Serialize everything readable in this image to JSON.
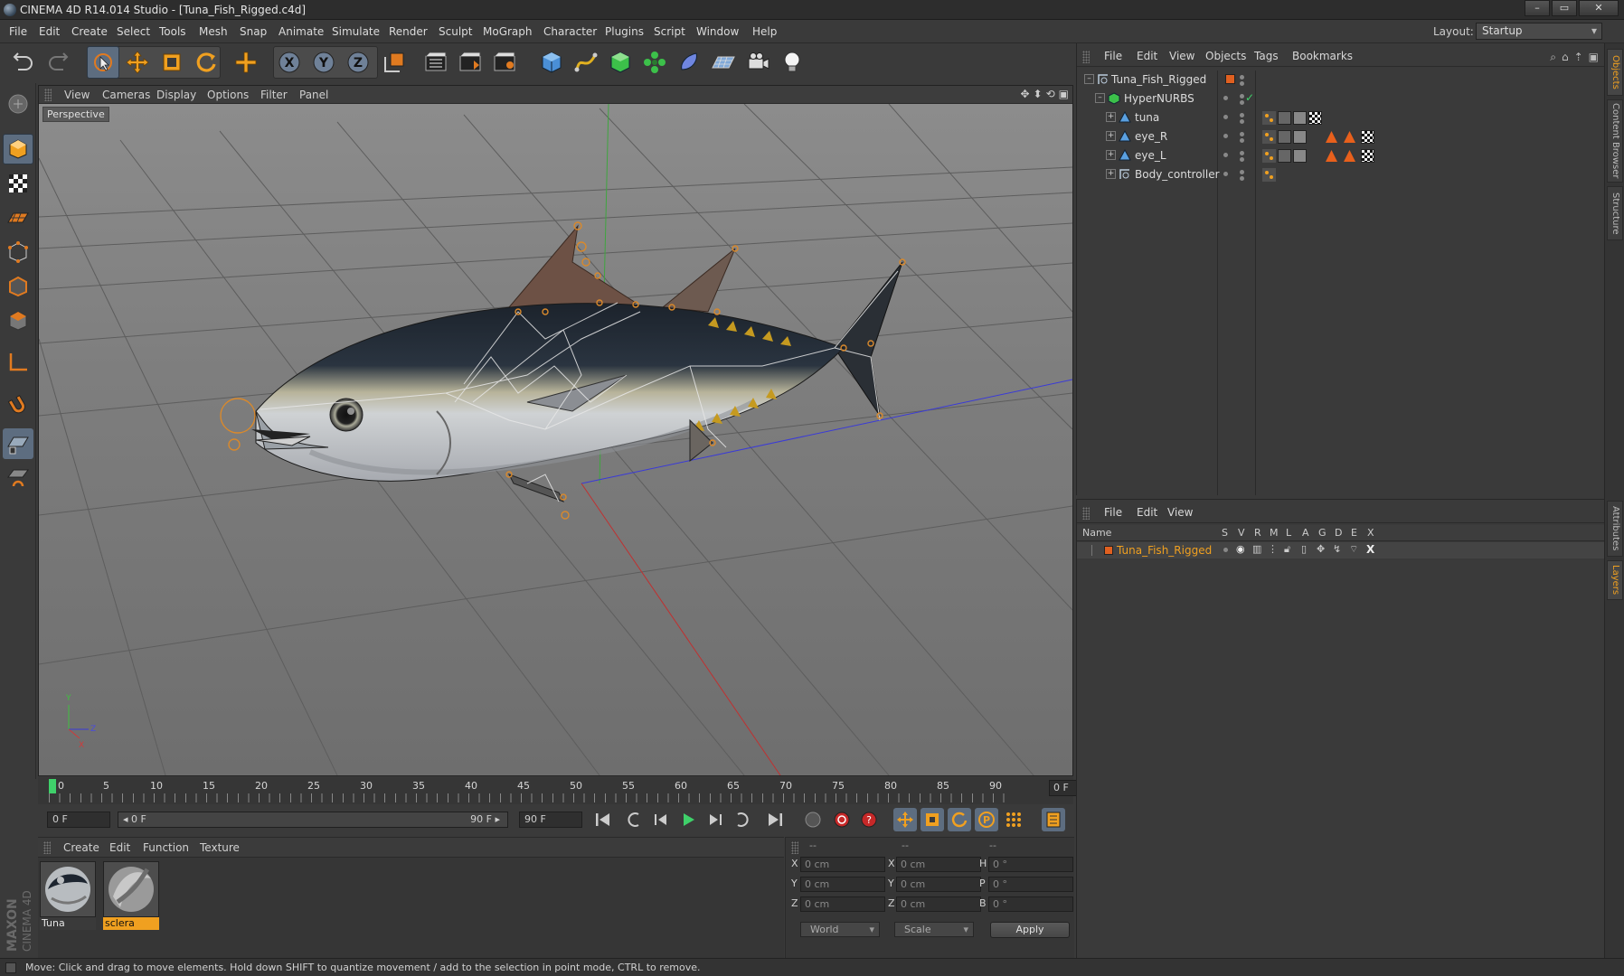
{
  "window": {
    "title": "CINEMA 4D R14.014 Studio - [Tuna_Fish_Rigged.c4d]",
    "buttons": [
      "–",
      "▭",
      "✕"
    ]
  },
  "menubar": {
    "items": [
      "File",
      "Edit",
      "Create",
      "Select",
      "Tools",
      "Mesh",
      "Snap",
      "Animate",
      "Simulate",
      "Render",
      "Sculpt",
      "MoGraph",
      "Character",
      "Plugins",
      "Script",
      "Window",
      "Help"
    ],
    "layout_label": "Layout:",
    "layout_value": "Startup"
  },
  "toolbar": {
    "icons": [
      "undo-icon",
      "redo-icon",
      "live-selection-icon",
      "move-icon",
      "scale-icon",
      "rotate-icon",
      "add-icon",
      "x-axis-lock-icon",
      "y-axis-lock-icon",
      "z-axis-lock-icon",
      "coordinate-system-icon",
      "render-view-icon",
      "render-picture-viewer-icon",
      "render-settings-icon",
      "cube-icon",
      "spline-icon",
      "nurbs-icon",
      "array-icon",
      "deformer-icon",
      "scene-floor-icon",
      "camera-icon",
      "light-icon"
    ]
  },
  "left_tools": [
    "model-mode-icon",
    "texture-mode-icon",
    "workplane-icon",
    "points-mode-icon",
    "edges-mode-icon",
    "polygons-mode-icon",
    "axis-mode-icon",
    "magnet-icon",
    "snap-icon",
    "locked-workplane-icon"
  ],
  "viewport": {
    "menu": [
      "View",
      "Cameras",
      "Display",
      "Options",
      "Filter",
      "Panel"
    ],
    "label": "Perspective"
  },
  "timeline": {
    "ticks": [
      "0",
      "5",
      "10",
      "15",
      "20",
      "25",
      "30",
      "35",
      "40",
      "45",
      "50",
      "55",
      "60",
      "65",
      "70",
      "75",
      "80",
      "85",
      "90"
    ],
    "current_frame": "0 F"
  },
  "transport": {
    "start_field": "0 F",
    "range_start": "◂ 0 F",
    "range_end": "90 F ▸",
    "end_field": "90 F"
  },
  "materials": {
    "menu": [
      "Create",
      "Edit",
      "Function",
      "Texture"
    ],
    "items": [
      {
        "name": "Tuna",
        "selected": false
      },
      {
        "name": "sclera",
        "selected": true
      }
    ]
  },
  "coordinates": {
    "headers": [
      "--",
      "--",
      "--"
    ],
    "rows": [
      {
        "axis": "X",
        "pos": "0 cm",
        "axis2": "X",
        "size": "0 cm",
        "axis3": "H",
        "rot": "0 °"
      },
      {
        "axis": "Y",
        "pos": "0 cm",
        "axis2": "Y",
        "size": "0 cm",
        "axis3": "P",
        "rot": "0 °"
      },
      {
        "axis": "Z",
        "pos": "0 cm",
        "axis2": "Z",
        "size": "0 cm",
        "axis3": "B",
        "rot": "0 °"
      }
    ],
    "space": "World",
    "mode": "Scale",
    "apply": "Apply"
  },
  "object_manager": {
    "menu": [
      "File",
      "Edit",
      "View",
      "Objects",
      "Tags",
      "Bookmarks"
    ],
    "objects": [
      {
        "name": "Tuna_Fish_Rigged",
        "level": 0,
        "icon": "null-icon"
      },
      {
        "name": "HyperNURBS",
        "level": 1,
        "icon": "hypernurbs-icon"
      },
      {
        "name": "tuna",
        "level": 2,
        "icon": "polygon-object-icon"
      },
      {
        "name": "eye_R",
        "level": 2,
        "icon": "polygon-object-icon"
      },
      {
        "name": "eye_L",
        "level": 2,
        "icon": "polygon-object-icon"
      },
      {
        "name": "Body_controller",
        "level": 2,
        "icon": "null-icon"
      }
    ]
  },
  "layer_manager": {
    "menu": [
      "File",
      "Edit",
      "View"
    ],
    "columns": [
      "Name",
      "S",
      "V",
      "R",
      "M",
      "L",
      "A",
      "G",
      "D",
      "E",
      "X"
    ],
    "layers": [
      {
        "name": "Tuna_Fish_Rigged",
        "color": "#e06020"
      }
    ]
  },
  "side_tabs": [
    "Objects",
    "Content Browser",
    "Structure",
    "Attributes",
    "Layers"
  ],
  "status": "Move: Click and drag to move elements. Hold down SHIFT to quantize movement / add to the selection in point mode, CTRL to remove.",
  "branding": {
    "maxon": "MAXON",
    "product": "CINEMA 4D"
  },
  "colors": {
    "accent_orange": "#f0a020",
    "selection_blue": "#5d6d80",
    "layer_color": "#e06020"
  }
}
